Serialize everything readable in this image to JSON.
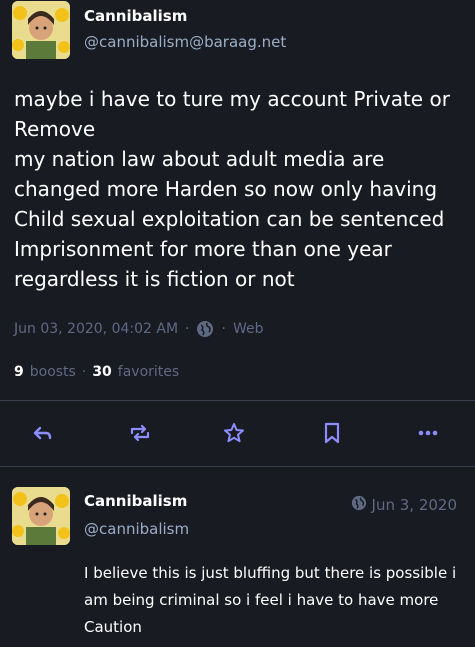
{
  "status": {
    "display_name": "Cannibalism",
    "account": "@cannibalism@baraag.net",
    "content": "maybe i have to ture my account Private or Remove\nmy nation law about adult media are changed more Harden so now only having Child sexual exploitation can be sentenced Imprisonment for more than one year regardless it is fiction or not",
    "timestamp": "Jun 03, 2020, 04:02 AM",
    "separator": "·",
    "visibility_icon": "globe-icon",
    "application": "Web",
    "boosts_count": "9",
    "boosts_label": "boosts",
    "favorites_count": "30",
    "favorites_label": "favorites"
  },
  "actions": [
    {
      "name": "reply",
      "icon": "reply-icon"
    },
    {
      "name": "boost",
      "icon": "boost-icon"
    },
    {
      "name": "favorite",
      "icon": "star-icon"
    },
    {
      "name": "bookmark",
      "icon": "bookmark-icon"
    },
    {
      "name": "more",
      "icon": "ellipsis-icon"
    }
  ],
  "reply": {
    "display_name": "Cannibalism",
    "account": "@cannibalism",
    "timestamp": "Jun 3, 2020",
    "content": "I believe this is just bluffing but there is possible i am being criminal so i feel i have to have more Caution"
  },
  "colors": {
    "background": "#191b22",
    "muted_text": "#606984",
    "account_text": "#9baec8",
    "divider": "#393f4f",
    "icon": "#8c8dff"
  }
}
